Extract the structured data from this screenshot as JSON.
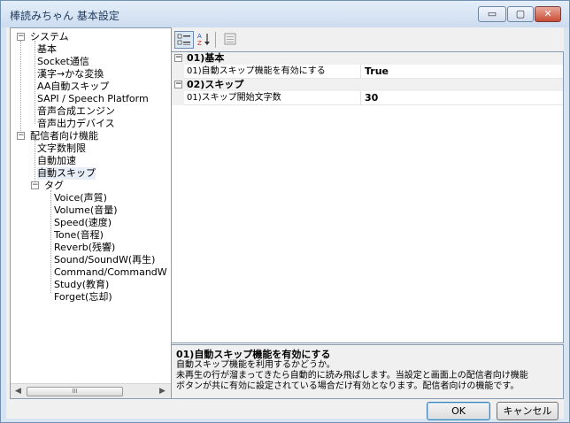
{
  "window": {
    "title": "棒読みちゃん 基本設定",
    "controls": {
      "minimize": "▭",
      "maximize": "▢",
      "close": "✕"
    }
  },
  "tree": {
    "nodes": [
      {
        "label": "システム",
        "expander": "−"
      },
      {
        "label": "基本"
      },
      {
        "label": "Socket通信"
      },
      {
        "label": "漢字→かな変換"
      },
      {
        "label": "AA自動スキップ"
      },
      {
        "label": "SAPI / Speech Platform"
      },
      {
        "label": "音声合成エンジン"
      },
      {
        "label": "音声出力デバイス"
      },
      {
        "label": "配信者向け機能",
        "expander": "−"
      },
      {
        "label": "文字数制限"
      },
      {
        "label": "自動加速"
      },
      {
        "label": "自動スキップ",
        "selected": true
      },
      {
        "label": "タグ",
        "expander": "−"
      },
      {
        "label": "Voice(声質)"
      },
      {
        "label": "Volume(音量)"
      },
      {
        "label": "Speed(速度)"
      },
      {
        "label": "Tone(音程)"
      },
      {
        "label": "Reverb(残響)"
      },
      {
        "label": "Sound/SoundW(再生)"
      },
      {
        "label": "Command/CommandW"
      },
      {
        "label": "Study(教育)"
      },
      {
        "label": "Forget(忘却)"
      }
    ],
    "hscroll": {
      "left_arrow": "◀",
      "right_arrow": "▶",
      "thumb_grip": "III"
    }
  },
  "toolbar": {
    "categorized_icon": "categorized-icon",
    "alphabetical_icon": "alphabetical-icon",
    "pages_icon": "property-pages-icon"
  },
  "grid": {
    "categories": [
      {
        "expander": "−",
        "label": "01)基本",
        "properties": [
          {
            "name": "01)自動スキップ機能を有効にする",
            "value": "True"
          }
        ]
      },
      {
        "expander": "−",
        "label": "02)スキップ",
        "properties": [
          {
            "name": "01)スキップ開始文字数",
            "value": "30"
          }
        ]
      }
    ]
  },
  "description": {
    "title": "01)自動スキップ機能を有効にする",
    "lines": [
      "自動スキップ機能を利用するかどうか。",
      "未再生の行が溜まってきたら自動的に読み飛ばします。当設定と画面上の配信者向け機能",
      "ボタンが共に有効に設定されている場合だけ有効となります。配信者向けの機能です。"
    ]
  },
  "buttons": {
    "ok": "OK",
    "cancel": "キャンセル"
  }
}
